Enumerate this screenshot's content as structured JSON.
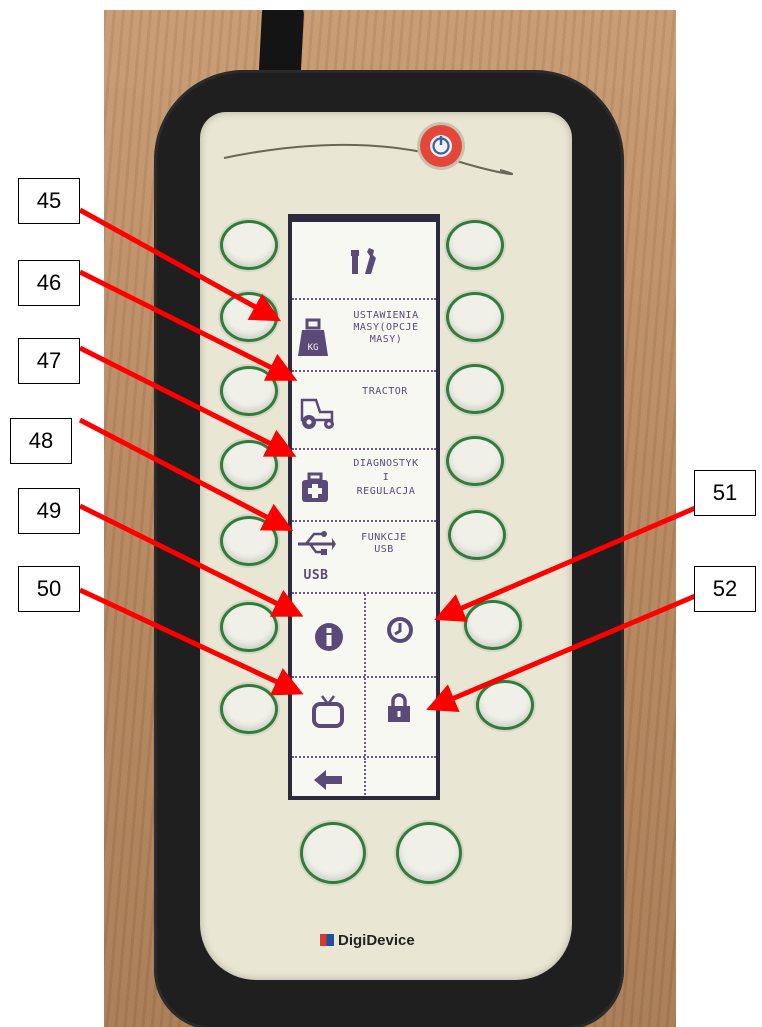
{
  "device": {
    "brand": "DigiDevice",
    "menu": {
      "weight_settings_lines": [
        "USTAWIENIA",
        "MASY(OPCJE",
        "MASY)"
      ],
      "tractor": "TRACTOR",
      "diagnostics_lines": [
        "DIAGNOSTYK",
        "I",
        "REGULACJA"
      ],
      "usb_functions_lines": [
        "FUNKCJE",
        "USB"
      ],
      "usb_icon_text": "USB",
      "kg_icon_text": "KG"
    }
  },
  "callouts": [
    "45",
    "46",
    "47",
    "48",
    "49",
    "50",
    "51",
    "52"
  ],
  "colors": {
    "screen_ink": "#5a4a78",
    "arrow": "#ff0000",
    "button_ring": "#2f7d3a",
    "power": "#e4473a"
  }
}
